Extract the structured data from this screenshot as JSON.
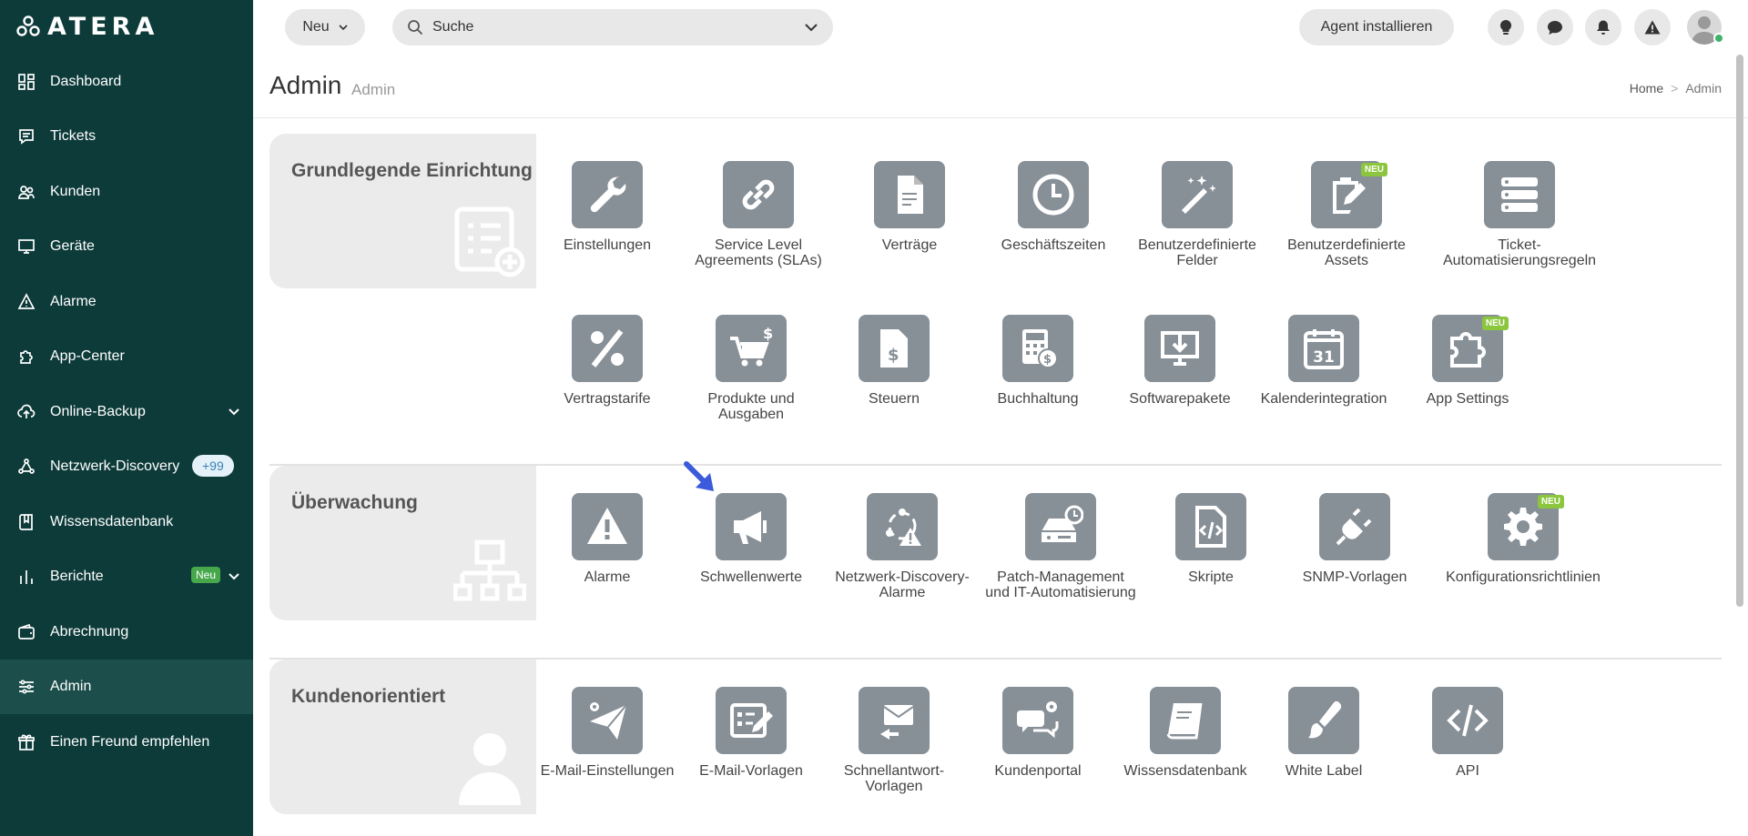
{
  "brand": {
    "logo_text": "ATERA"
  },
  "sidebar": {
    "items": [
      {
        "label": "Dashboard"
      },
      {
        "label": "Tickets"
      },
      {
        "label": "Kunden"
      },
      {
        "label": "Geräte"
      },
      {
        "label": "Alarme"
      },
      {
        "label": "App-Center"
      },
      {
        "label": "Online-Backup"
      },
      {
        "label": "Netzwerk-Discovery",
        "badge": "+99"
      },
      {
        "label": "Wissensdatenbank"
      },
      {
        "label": "Berichte",
        "badge": "Neu"
      },
      {
        "label": "Abrechnung"
      },
      {
        "label": "Admin"
      },
      {
        "label": "Einen Freund empfehlen"
      }
    ]
  },
  "header": {
    "new_label": "Neu",
    "search_placeholder": "Suche",
    "agent_label": "Agent installieren"
  },
  "page": {
    "title": "Admin",
    "subtitle": "Admin",
    "breadcrumb": {
      "home": "Home",
      "sep": ">",
      "current": "Admin"
    }
  },
  "sections": {
    "setup": {
      "title": "Grundlegende Einrichtung",
      "tiles": [
        {
          "label": "Einstellungen"
        },
        {
          "label": "Service Level Agreements (SLAs)"
        },
        {
          "label": "Verträge"
        },
        {
          "label": "Geschäftszeiten"
        },
        {
          "label": "Benutzerdefinierte Felder"
        },
        {
          "label": "Benutzerdefinierte Assets",
          "badge": "NEU"
        },
        {
          "label": "Ticket-Automatisierungsregeln"
        },
        {
          "label": "Vertragstarife"
        },
        {
          "label": "Produkte und Ausgaben"
        },
        {
          "label": "Steuern"
        },
        {
          "label": "Buchhaltung"
        },
        {
          "label": "Softwarepakete"
        },
        {
          "label": "Kalenderintegration",
          "calendar_day": "31"
        },
        {
          "label": "App Settings",
          "badge": "NEU"
        }
      ]
    },
    "monitoring": {
      "title": "Überwachung",
      "tiles": [
        {
          "label": "Alarme"
        },
        {
          "label": "Schwellenwerte"
        },
        {
          "label": "Netzwerk-Discovery-Alarme"
        },
        {
          "label": "Patch-Management und IT-Automatisierung"
        },
        {
          "label": "Skripte"
        },
        {
          "label": "SNMP-Vorlagen"
        },
        {
          "label": "Konfigurationsrichtlinien",
          "badge": "NEU"
        }
      ]
    },
    "customer": {
      "title": "Kundenorientiert",
      "tiles": [
        {
          "label": "E-Mail-Einstellungen"
        },
        {
          "label": "E-Mail-Vorlagen"
        },
        {
          "label": "Schnellantwort-Vorlagen"
        },
        {
          "label": "Kundenportal"
        },
        {
          "label": "Wissensdatenbank"
        },
        {
          "label": "White Label"
        },
        {
          "label": "API"
        }
      ]
    }
  },
  "colors": {
    "sidebar_bg": "#0d3b3a",
    "tile_icon_bg": "#878f97",
    "badge_new": "#8cc63f",
    "pointer_arrow": "#3b5bdb"
  }
}
